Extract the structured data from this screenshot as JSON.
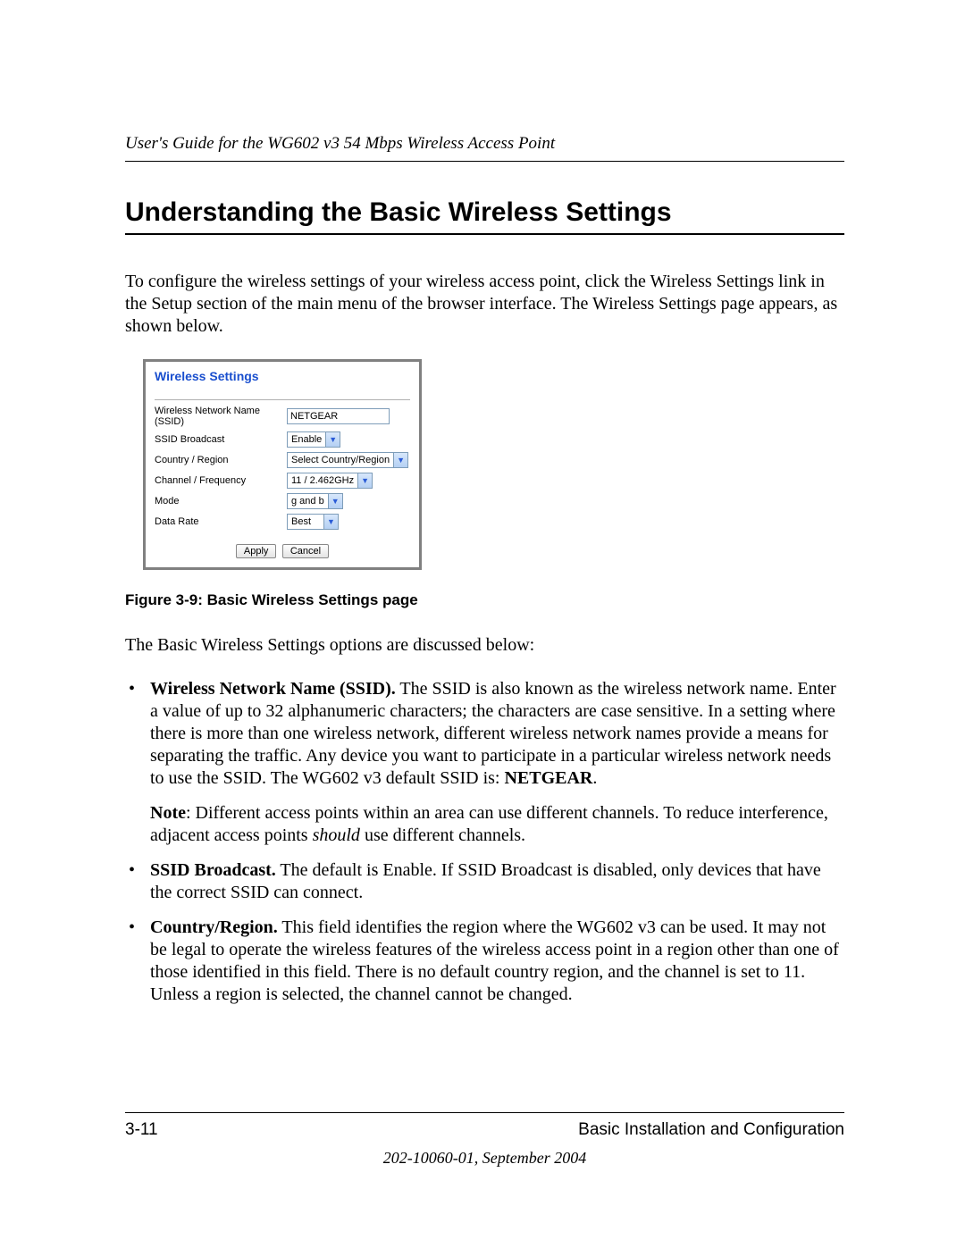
{
  "header": {
    "running_head": "User's Guide for the WG602 v3 54 Mbps Wireless Access Point"
  },
  "section": {
    "title": "Understanding the Basic Wireless Settings",
    "intro": "To configure the wireless settings of your wireless access point, click the Wireless Settings link in the Setup section of the main menu of the browser interface. The Wireless Settings page appears, as shown below."
  },
  "panel": {
    "title": "Wireless Settings",
    "fields": {
      "ssid_label": "Wireless Network Name (SSID)",
      "ssid_value": "NETGEAR",
      "broadcast_label": "SSID Broadcast",
      "broadcast_value": "Enable",
      "country_label": "Country / Region",
      "country_value": "Select Country/Region",
      "channel_label": "Channel / Frequency",
      "channel_value": "11 / 2.462GHz",
      "mode_label": "Mode",
      "mode_value": "g and b",
      "rate_label": "Data Rate",
      "rate_value": "Best"
    },
    "buttons": {
      "apply": "Apply",
      "cancel": "Cancel"
    }
  },
  "caption": "Figure 3-9: Basic Wireless Settings page",
  "discussion_intro": "The Basic Wireless Settings options are discussed below:",
  "bullets": {
    "ssid": {
      "lead": "Wireless Network Name (SSID).",
      "text_a": " The SSID is also known as the wireless network name. Enter a value of up to 32 alphanumeric characters; the characters are case sensitive. In a setting where there is more than one wireless network, different wireless network names provide a means for separating the traffic. Any device you want to participate in a particular wireless network needs to use the SSID. The WG602 v3 default SSID is: ",
      "default": "NETGEAR",
      "text_b": "."
    },
    "note": {
      "lead": "Note",
      "text_a": ": Different access points within an area can use different channels. To reduce interference, adjacent access points ",
      "should": "should",
      "text_b": " use different channels."
    },
    "broadcast": {
      "lead": "SSID Broadcast.",
      "text": " The default is Enable. If SSID Broadcast is disabled, only devices that have the correct SSID can connect."
    },
    "country": {
      "lead": "Country/Region.",
      "text": " This field identifies the region where the WG602 v3 can be used. It may not be legal to operate the wireless features of the wireless access point in a region other than one of those identified in this field. There is no default country region, and the channel is set to 11. Unless a region is selected, the channel cannot be changed."
    }
  },
  "footer": {
    "page": "3-11",
    "chapter": "Basic Installation and Configuration",
    "docnum": "202-10060-01, September 2004"
  }
}
